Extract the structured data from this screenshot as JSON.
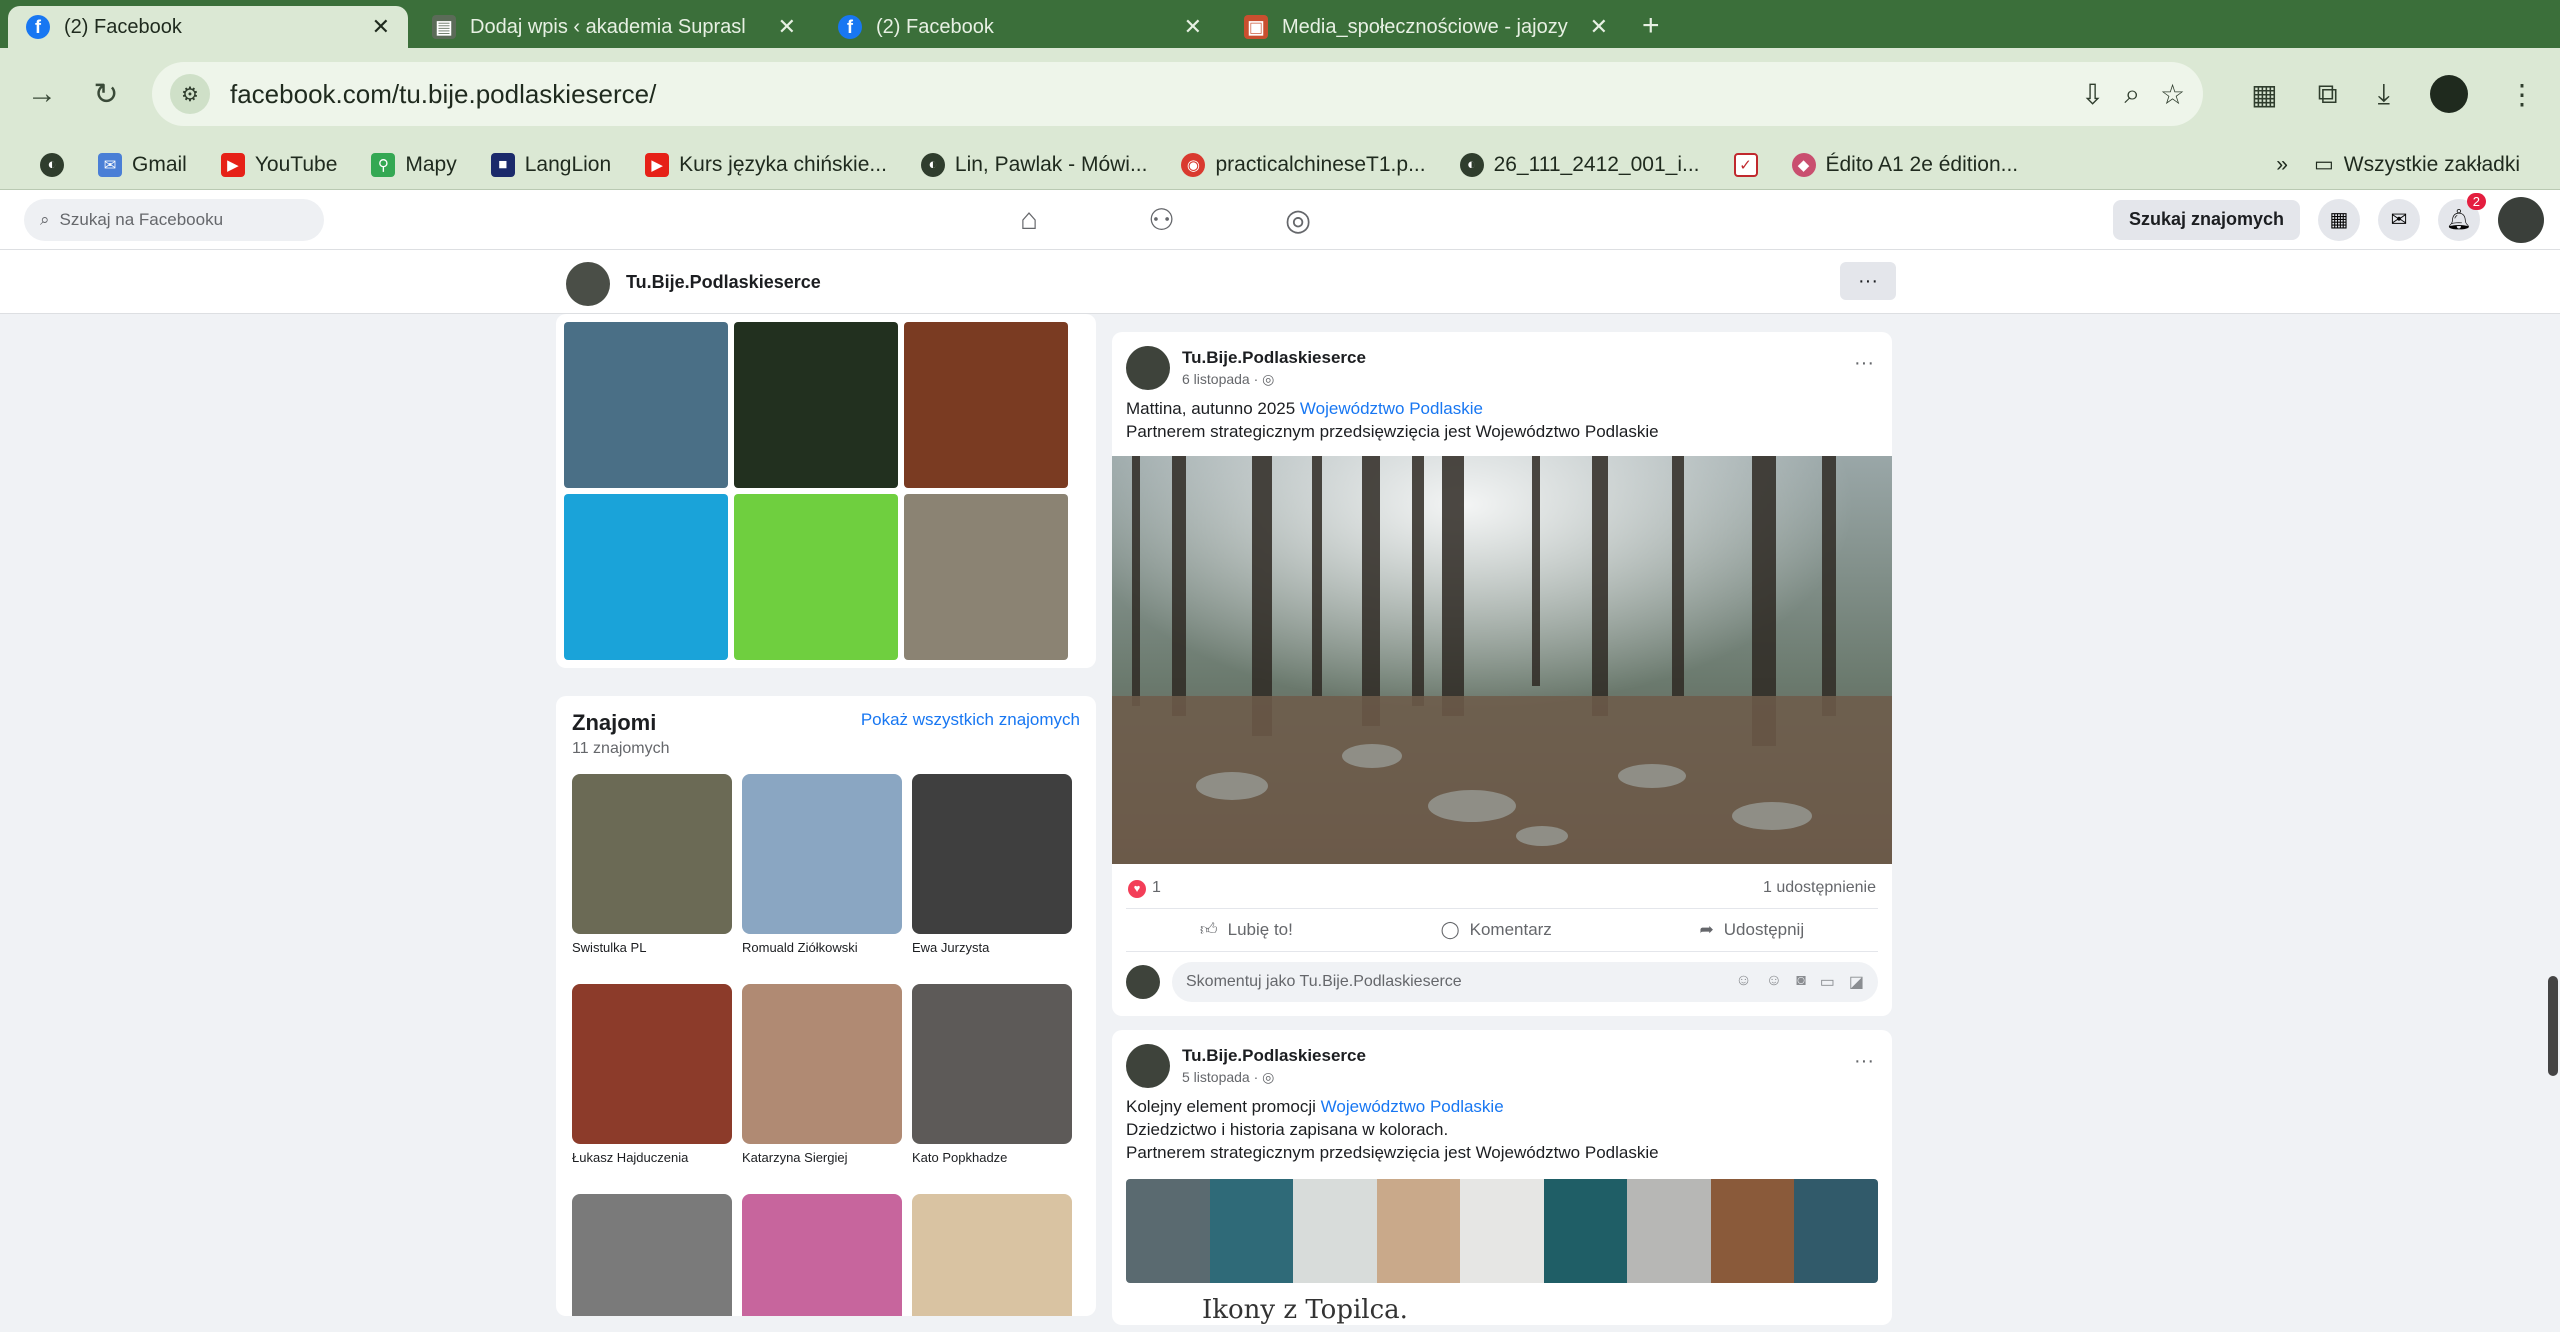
{
  "browser": {
    "tabs": [
      {
        "title": "(2) Facebook",
        "icon": "facebook-icon",
        "active": true
      },
      {
        "title": "Dodaj wpis ‹ akademia Suprasl",
        "icon": "book-icon",
        "active": false
      },
      {
        "title": "(2) Facebook",
        "icon": "facebook-icon",
        "active": false
      },
      {
        "title": "Media_społecznościowe - jajozy",
        "icon": "image-icon",
        "active": false
      }
    ],
    "url": "facebook.com/tu.bije.podlaskieserce/",
    "bookmarks": [
      "Gmail",
      "YouTube",
      "Mapy",
      "LangLion",
      "Kurs języka chińskie...",
      "Lin, Pawlak - Mówi...",
      "practicalchineseT1.p...",
      "26_111_2412_001_i...",
      "Édito A1 2e édition..."
    ],
    "bookmarks_overflow": "»",
    "all_bookmarks": "Wszystkie zakładki"
  },
  "fb": {
    "search_placeholder": "Szukaj na Facebooku",
    "find_friends": "Szukaj znajomych",
    "notifications_count": "2",
    "page_name": "Tu.Bije.Podlaskieserce",
    "more": "···"
  },
  "photos": {
    "colors": [
      "#4a6f86",
      "#22301f",
      "#7a3b22",
      "#1aa3d9",
      "#6fcf3f",
      "#8b8373"
    ]
  },
  "friends": {
    "title": "Znajomi",
    "count": "11 znajomych",
    "show_all": "Pokaż wszystkich znajomych",
    "items": [
      {
        "name": "Swistulka PL",
        "color": "#6b6a55"
      },
      {
        "name": "Romuald Ziółkowski",
        "color": "#8aa6c2"
      },
      {
        "name": "Ewa Jurzysta",
        "color": "#3f3f3f"
      },
      {
        "name": "Łukasz Hajduczenia",
        "color": "#8c3b2a"
      },
      {
        "name": "Katarzyna Siergiej",
        "color": "#b08a73"
      },
      {
        "name": "Kato Popkhadze",
        "color": "#5d5a58"
      },
      {
        "name": "",
        "color": "#7a7a7a"
      },
      {
        "name": "",
        "color": "#c7659d"
      },
      {
        "name": "",
        "color": "#d9c3a2"
      }
    ]
  },
  "posts": [
    {
      "author": "Tu.Bije.Podlaskieserce",
      "date": "6 listopada · ◎",
      "text_prefix": "Mattina, autunno 2025 ",
      "text_link": "Województwo Podlaskie",
      "text_line2": "Partnerem strategicznym przedsięwzięcia jest Województwo Podlaskie",
      "reactions": "1",
      "shares": "1 udostępnienie",
      "like": "Lubię to!",
      "comment": "Komentarz",
      "share": "Udostępnij",
      "comment_placeholder": "Skomentuj jako Tu.Bije.Podlaskieserce"
    },
    {
      "author": "Tu.Bije.Podlaskieserce",
      "date": "5 listopada · ◎",
      "text_prefix": "Kolejny element promocji ",
      "text_link": "Województwo Podlaskie",
      "text_line2": "Dziedzictwo i historia zapisana w kolorach.",
      "text_line3": "Partnerem strategicznym przedsięwzięcia jest Województwo Podlaskie",
      "image_caption": "Ikony z Topilca."
    }
  ]
}
